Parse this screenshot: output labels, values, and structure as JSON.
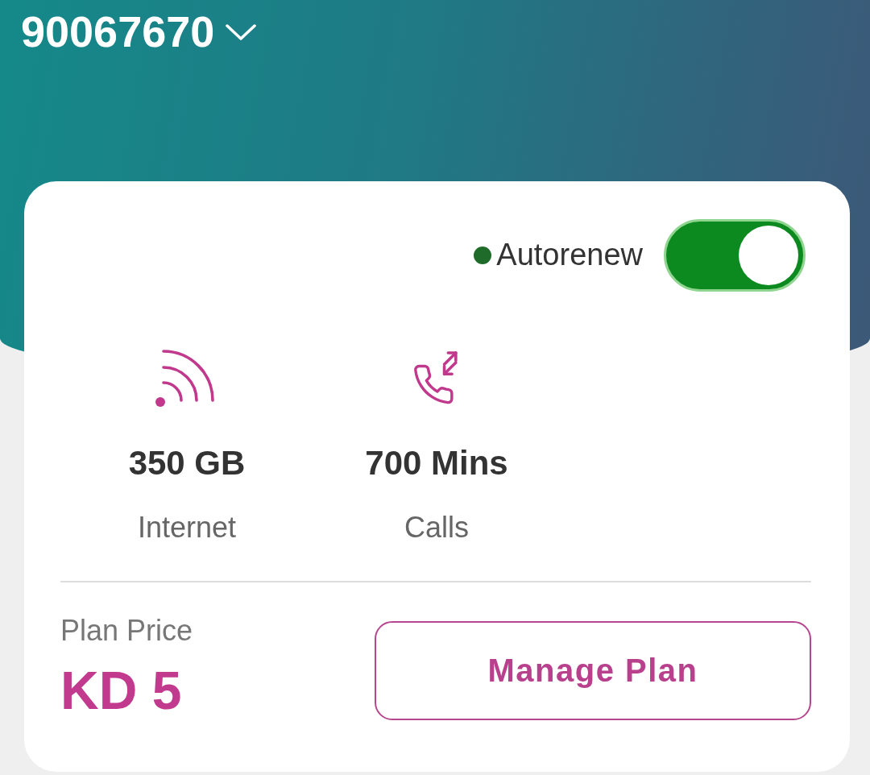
{
  "header": {
    "phone_number": "90067670"
  },
  "plan": {
    "autorenew": {
      "label": "Autorenew",
      "on": true
    },
    "allowances": [
      {
        "kind": "internet",
        "amount": "350 GB",
        "label": "Internet"
      },
      {
        "kind": "calls",
        "amount": "700 Mins",
        "label": "Calls"
      }
    ],
    "price": {
      "label": "Plan Price",
      "value": "KD 5"
    },
    "manage_button": "Manage Plan"
  }
}
